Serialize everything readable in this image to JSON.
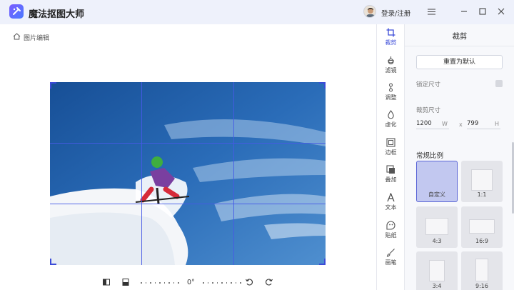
{
  "app": {
    "title": "魔法抠图大师",
    "login": "登录/注册"
  },
  "breadcrumb": {
    "label": "图片编辑"
  },
  "rotation": {
    "angle": "0°"
  },
  "tools": [
    {
      "id": "crop",
      "label": "裁剪",
      "active": true
    },
    {
      "id": "filter",
      "label": "滤镜"
    },
    {
      "id": "adjust",
      "label": "调整"
    },
    {
      "id": "blur",
      "label": "虚化"
    },
    {
      "id": "border",
      "label": "边框"
    },
    {
      "id": "overlay",
      "label": "叠加"
    },
    {
      "id": "text",
      "label": "文本"
    },
    {
      "id": "sticker",
      "label": "贴纸"
    },
    {
      "id": "brush",
      "label": "画笔"
    }
  ],
  "panel": {
    "title": "裁剪",
    "reset_label": "重置为默认",
    "lock_label": "锁定尺寸",
    "size_label": "裁剪尺寸",
    "width_value": "1200",
    "width_unit": "W",
    "times": "x",
    "height_value": "799",
    "height_unit": "H",
    "ratio_section": "常规比例",
    "ratios": [
      "自定义",
      "1:1",
      "4:3",
      "16:9",
      "3:4",
      "9:16"
    ]
  },
  "colors": {
    "accent": "#3b4bd8",
    "titlebar": "#eef1fb",
    "sky": "#1f5fa8"
  }
}
